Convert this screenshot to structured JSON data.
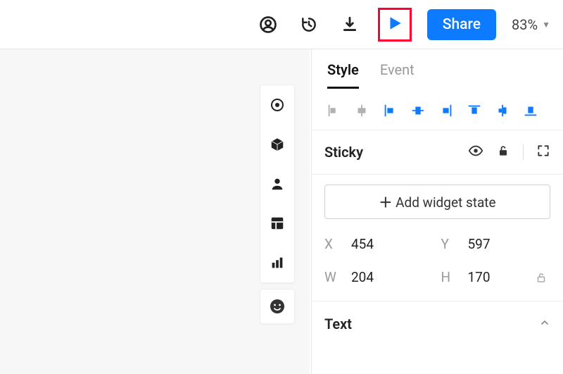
{
  "topbar": {
    "share_label": "Share",
    "zoom_label": "83%"
  },
  "tabs": {
    "style": "Style",
    "event": "Event"
  },
  "sticky": {
    "label": "Sticky",
    "add_state": "Add widget state"
  },
  "coords": {
    "x_key": "X",
    "x_val": "454",
    "y_key": "Y",
    "y_val": "597",
    "w_key": "W",
    "w_val": "204",
    "h_key": "H",
    "h_val": "170"
  },
  "text_section": {
    "label": "Text"
  }
}
